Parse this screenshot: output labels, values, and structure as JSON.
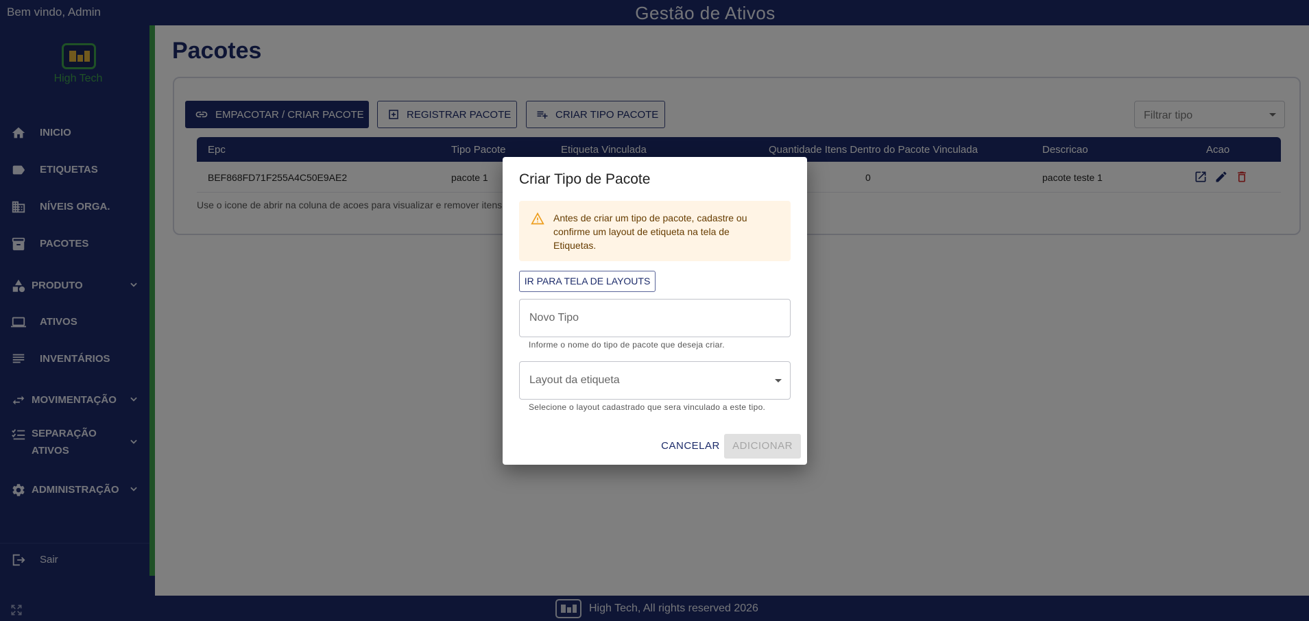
{
  "header": {
    "welcome": "Bem vindo, Admin",
    "app_title": "Gestão de Ativos"
  },
  "sidebar": {
    "logo_text": "High Tech",
    "items": [
      {
        "label": "INICIO",
        "icon": "home-icon"
      },
      {
        "label": "ETIQUETAS",
        "icon": "label-icon"
      },
      {
        "label": "NÍVEIS ORGA.",
        "icon": "building-icon"
      },
      {
        "label": "PACOTES",
        "icon": "archive-icon"
      },
      {
        "label": "PRODUTO",
        "icon": "category-icon"
      },
      {
        "label": "ATIVOS",
        "icon": "laptop-icon"
      },
      {
        "label": "INVENTÁRIOS",
        "icon": "list-icon"
      },
      {
        "label": "MOVIMENTAÇÃO",
        "icon": "swap-icon"
      },
      {
        "label_line1": "SEPARAÇÃO",
        "label_line2": "ATIVOS",
        "icon": "checklist-icon"
      },
      {
        "label": "ADMINISTRAÇÃO",
        "icon": "gear-icon"
      }
    ],
    "logout": "Sair"
  },
  "main": {
    "title": "Pacotes",
    "toolbar": {
      "pack_label": "EMPACOTAR / CRIAR PACOTE",
      "register_label": "REGISTRAR PACOTE",
      "create_type_label": "CRIAR TIPO PACOTE",
      "filter_placeholder": "Filtrar tipo"
    },
    "table": {
      "headers": [
        "Epc",
        "Tipo Pacote",
        "Etiqueta Vinculada",
        "Quantidade Itens Dentro do Pacote Vinculada",
        "Descricao",
        "Acao"
      ],
      "rows": [
        {
          "epc": "BEF868FD71F255A4C50E9AE2",
          "tipo": "pacote 1",
          "etiqueta": "",
          "quantidade": "0",
          "descricao": "pacote teste 1"
        }
      ]
    },
    "hint": "Use o icone de abrir na coluna de acoes para visualizar e remover itens do pacote."
  },
  "footer": {
    "text": "High Tech, All rights reserved 2026"
  },
  "dialog": {
    "title": "Criar Tipo de Pacote",
    "alert": "Antes de criar um tipo de pacote, cadastre ou confirme um layout de etiqueta na tela de Etiquetas.",
    "layouts_button": "IR PARA TELA DE LAYOUTS",
    "name_placeholder": "Novo Tipo",
    "name_helper": "Informe o nome do tipo de pacote que deseja criar.",
    "layout_placeholder": "Layout da etiqueta",
    "layout_helper": "Selecione o layout cadastrado que sera vinculado a este tipo.",
    "cancel": "CANCELAR",
    "add": "ADICIONAR"
  },
  "colors": {
    "primary": "#1c2b6a",
    "accent_green": "#3fa34d",
    "warning_bg": "#fff4e5",
    "warning_icon": "#ed9c1b",
    "delete_red": "#d32f2f"
  }
}
